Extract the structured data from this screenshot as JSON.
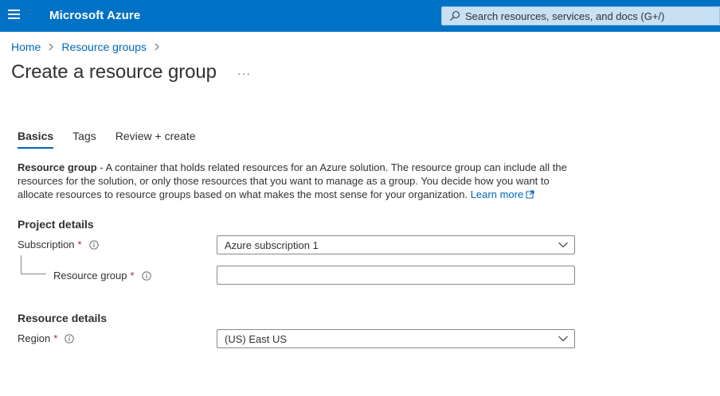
{
  "topbar": {
    "brand": "Microsoft Azure",
    "search_placeholder": "Search resources, services, and docs (G+/)"
  },
  "breadcrumb": {
    "items": [
      "Home",
      "Resource groups"
    ]
  },
  "page": {
    "title": "Create a resource group",
    "more_label": "···"
  },
  "tabs": [
    {
      "label": "Basics",
      "active": true
    },
    {
      "label": "Tags",
      "active": false
    },
    {
      "label": "Review + create",
      "active": false
    }
  ],
  "description": {
    "term": "Resource group",
    "text": " - A container that holds related resources for an Azure solution. The resource group can include all the resources for the solution, or only those resources that you want to manage as a group. You decide how you want to allocate resources to resource groups based on what makes the most sense for your organization. ",
    "link": "Learn more"
  },
  "project_details": {
    "heading": "Project details",
    "subscription_label": "Subscription",
    "subscription_value": "Azure subscription 1",
    "resource_group_label": "Resource group",
    "resource_group_value": ""
  },
  "resource_details": {
    "heading": "Resource details",
    "region_label": "Region",
    "region_value": "(US) East US"
  },
  "required_marker": "*",
  "colors": {
    "topbar": "#0072c6",
    "link": "#0067b8",
    "required": "#a4262c"
  }
}
